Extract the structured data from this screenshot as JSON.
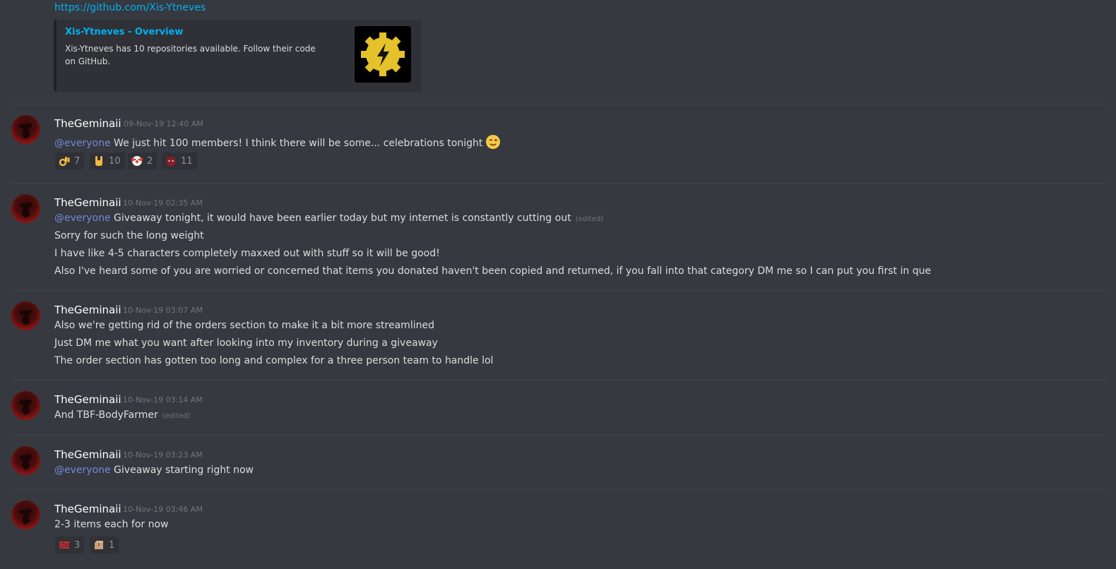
{
  "prev_link": "https://github.com/Xis-Ytneves",
  "embed": {
    "title": "Xis-Ytneves - Overview",
    "description": "Xis-Ytneves has 10 repositories available. Follow their code on GitHub.",
    "thumbnail_icon": "lightning-gear-icon"
  },
  "colors": {
    "background": "#36393f",
    "link": "#00b0f4",
    "mention": "#7289da",
    "timestamp": "#72767d"
  },
  "messages": [
    {
      "username": "TheGeminaii",
      "timestamp": "09-Nov-19 12:40 AM",
      "mention": "@everyone",
      "text": " We just hit 100 members! I think there will be some... celebrations tonight",
      "trailing_emoji": "winking-face-emoji",
      "reactions": [
        {
          "emoji": "ok-hand-emoji",
          "count": "7"
        },
        {
          "emoji": "rock-hand-emoji",
          "count": "10"
        },
        {
          "emoji": "clown-face-emoji",
          "count": "2"
        },
        {
          "emoji": "devil-face-emoji",
          "count": "11"
        }
      ]
    },
    {
      "username": "TheGeminaii",
      "timestamp": "10-Nov-19 02:35 AM",
      "mention": "@everyone",
      "line1": " Giveaway tonight, it would have been earlier today but my internet is constantly cutting out",
      "edited": "(edited)",
      "line2": "Sorry for such the long weight",
      "line3": "I have like 4-5 characters completely maxxed out with stuff so it will be good!",
      "line4": "Also I've heard some of you are worried or concerned that items you donated haven't been copied and returned, if you fall into that category DM me so I can put you first in que"
    },
    {
      "username": "TheGeminaii",
      "timestamp": "10-Nov-19 03:07 AM",
      "line1": "Also we're getting rid of the orders section to make it a bit more streamlined",
      "line2": "Just DM me what you want after looking into my inventory during a giveaway",
      "line3": "The order section has gotten too long and complex for a three person team to handle lol"
    },
    {
      "username": "TheGeminaii",
      "timestamp": "10-Nov-19 03:14 AM",
      "line1": "And TBF-BodyFarmer",
      "edited": "(edited)"
    },
    {
      "username": "TheGeminaii",
      "timestamp": "10-Nov-19 03:23 AM",
      "mention": "@everyone",
      "line1": " Giveaway starting right now"
    },
    {
      "username": "TheGeminaii",
      "timestamp": "10-Nov-19 03:46 AM",
      "line1": "2-3 items each for now",
      "reactions": [
        {
          "emoji": "brick-emoji",
          "count": "3"
        },
        {
          "emoji": "package-emoji",
          "count": "1"
        }
      ]
    }
  ]
}
